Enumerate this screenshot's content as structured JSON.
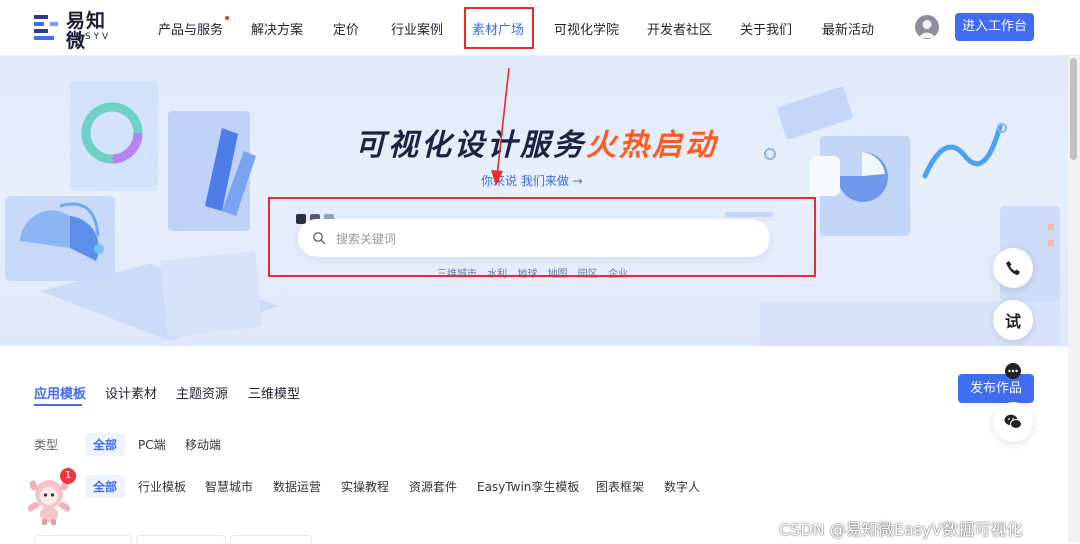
{
  "header": {
    "logo_cn": "易知微",
    "logo_en": "EASYV",
    "nav": [
      {
        "label": "产品与服务",
        "has_dot": true
      },
      {
        "label": "解决方案"
      },
      {
        "label": "定价"
      },
      {
        "label": "行业案例"
      },
      {
        "label": "素材广场",
        "highlighted": true
      },
      {
        "label": "可视化学院"
      },
      {
        "label": "开发者社区"
      },
      {
        "label": "关于我们"
      },
      {
        "label": "最新活动"
      }
    ],
    "enter_button": "进入工作台"
  },
  "hero": {
    "title_main": "可视化设计服务",
    "title_hot": "火热启动",
    "subtitle": "你来说 我们来做 →",
    "search_placeholder": "搜索关键词",
    "tags": [
      "三维城市",
      "水利",
      "地球",
      "地图",
      "园区",
      "企业"
    ]
  },
  "section": {
    "tabs": [
      "应用模板",
      "设计素材",
      "主题资源",
      "三维模型"
    ],
    "active_tab": 0,
    "publish_button": "发布作品",
    "type_label": "类型",
    "type_options": [
      "全部",
      "PC端",
      "移动端"
    ],
    "category_options": [
      "全部",
      "行业模板",
      "智慧城市",
      "数据运营",
      "实操教程",
      "资源套件",
      "EasyTwin孪生模板",
      "图表框架",
      "数字人"
    ]
  },
  "floating": {
    "try_label": "试",
    "badge_count": "1"
  },
  "colors": {
    "accent": "#3f6cf0",
    "highlight_box": "#e52d2d",
    "hot_text": "#ff5a1f"
  },
  "icons": [
    "search-icon",
    "phone-icon",
    "chat-icon",
    "wechat-icon",
    "avatar-icon"
  ],
  "watermark": "CSDN @易知微EasyV数据可视化"
}
